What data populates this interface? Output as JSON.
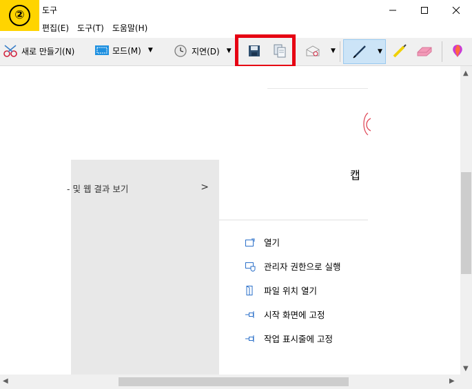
{
  "window": {
    "title": "도구",
    "step_badge": "②"
  },
  "menu": {
    "items": [
      "편집(E)",
      "도구(T)",
      "도움말(H)"
    ]
  },
  "toolbar": {
    "new_label": "새로 만들기(N)",
    "mode_label": "모드(M)",
    "delay_label": "지연(D)"
  },
  "content": {
    "capture_text": "캡",
    "left_menu_text": "및 웹 결과 보기",
    "context_items": [
      {
        "label": "열기"
      },
      {
        "label": "관리자 권한으로 실행"
      },
      {
        "label": "파일 위치 열기"
      },
      {
        "label": "시작 화면에 고정"
      },
      {
        "label": "작업 표시줄에 고정"
      }
    ]
  },
  "colors": {
    "highlight": "#e60012",
    "badge": "#ffd400",
    "toolbar_bg": "#f0f0f0"
  }
}
